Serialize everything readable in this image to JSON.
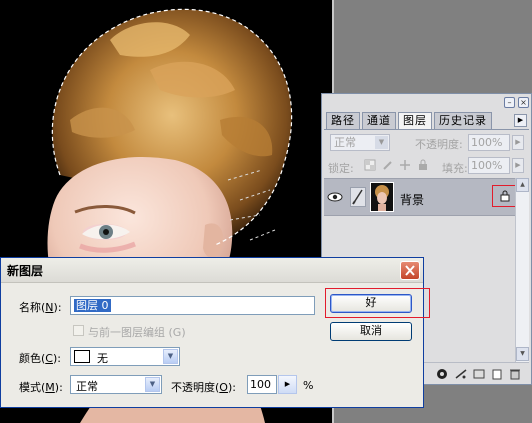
{
  "palette": {
    "tabs": [
      {
        "label": "路径",
        "active": false
      },
      {
        "label": "通道",
        "active": false
      },
      {
        "label": "图层",
        "active": true
      },
      {
        "label": "历史记录",
        "active": false
      }
    ],
    "blend_mode": "正常",
    "opacity_label": "不透明度:",
    "opacity_value": "100%",
    "lock_label": "锁定:",
    "fill_label": "填充:",
    "fill_value": "100%",
    "layer": {
      "name": "背景",
      "locked": true,
      "visible": true
    }
  },
  "dialog": {
    "title": "新图层",
    "name_label": "名称(",
    "name_key": "N",
    "name_label_end": "):",
    "name_value": "图层 0",
    "group_label": "与前一图层编组",
    "group_key": "(G)",
    "color_label": "颜色(",
    "color_key": "C",
    "color_label_end": "):",
    "color_value": "无",
    "mode_label": "模式(",
    "mode_key": "M",
    "mode_label_end": "):",
    "mode_value": "正常",
    "opacity_label": "不透明度(",
    "opacity_key": "O",
    "opacity_label_end": "):",
    "opacity_value": "100",
    "opacity_unit": "%",
    "ok_label": "好",
    "cancel_label": "取消"
  },
  "colors": {
    "highlight": "#e21c2c",
    "titlebar_border": "#0f3ea0",
    "hair": "#c9913f"
  }
}
